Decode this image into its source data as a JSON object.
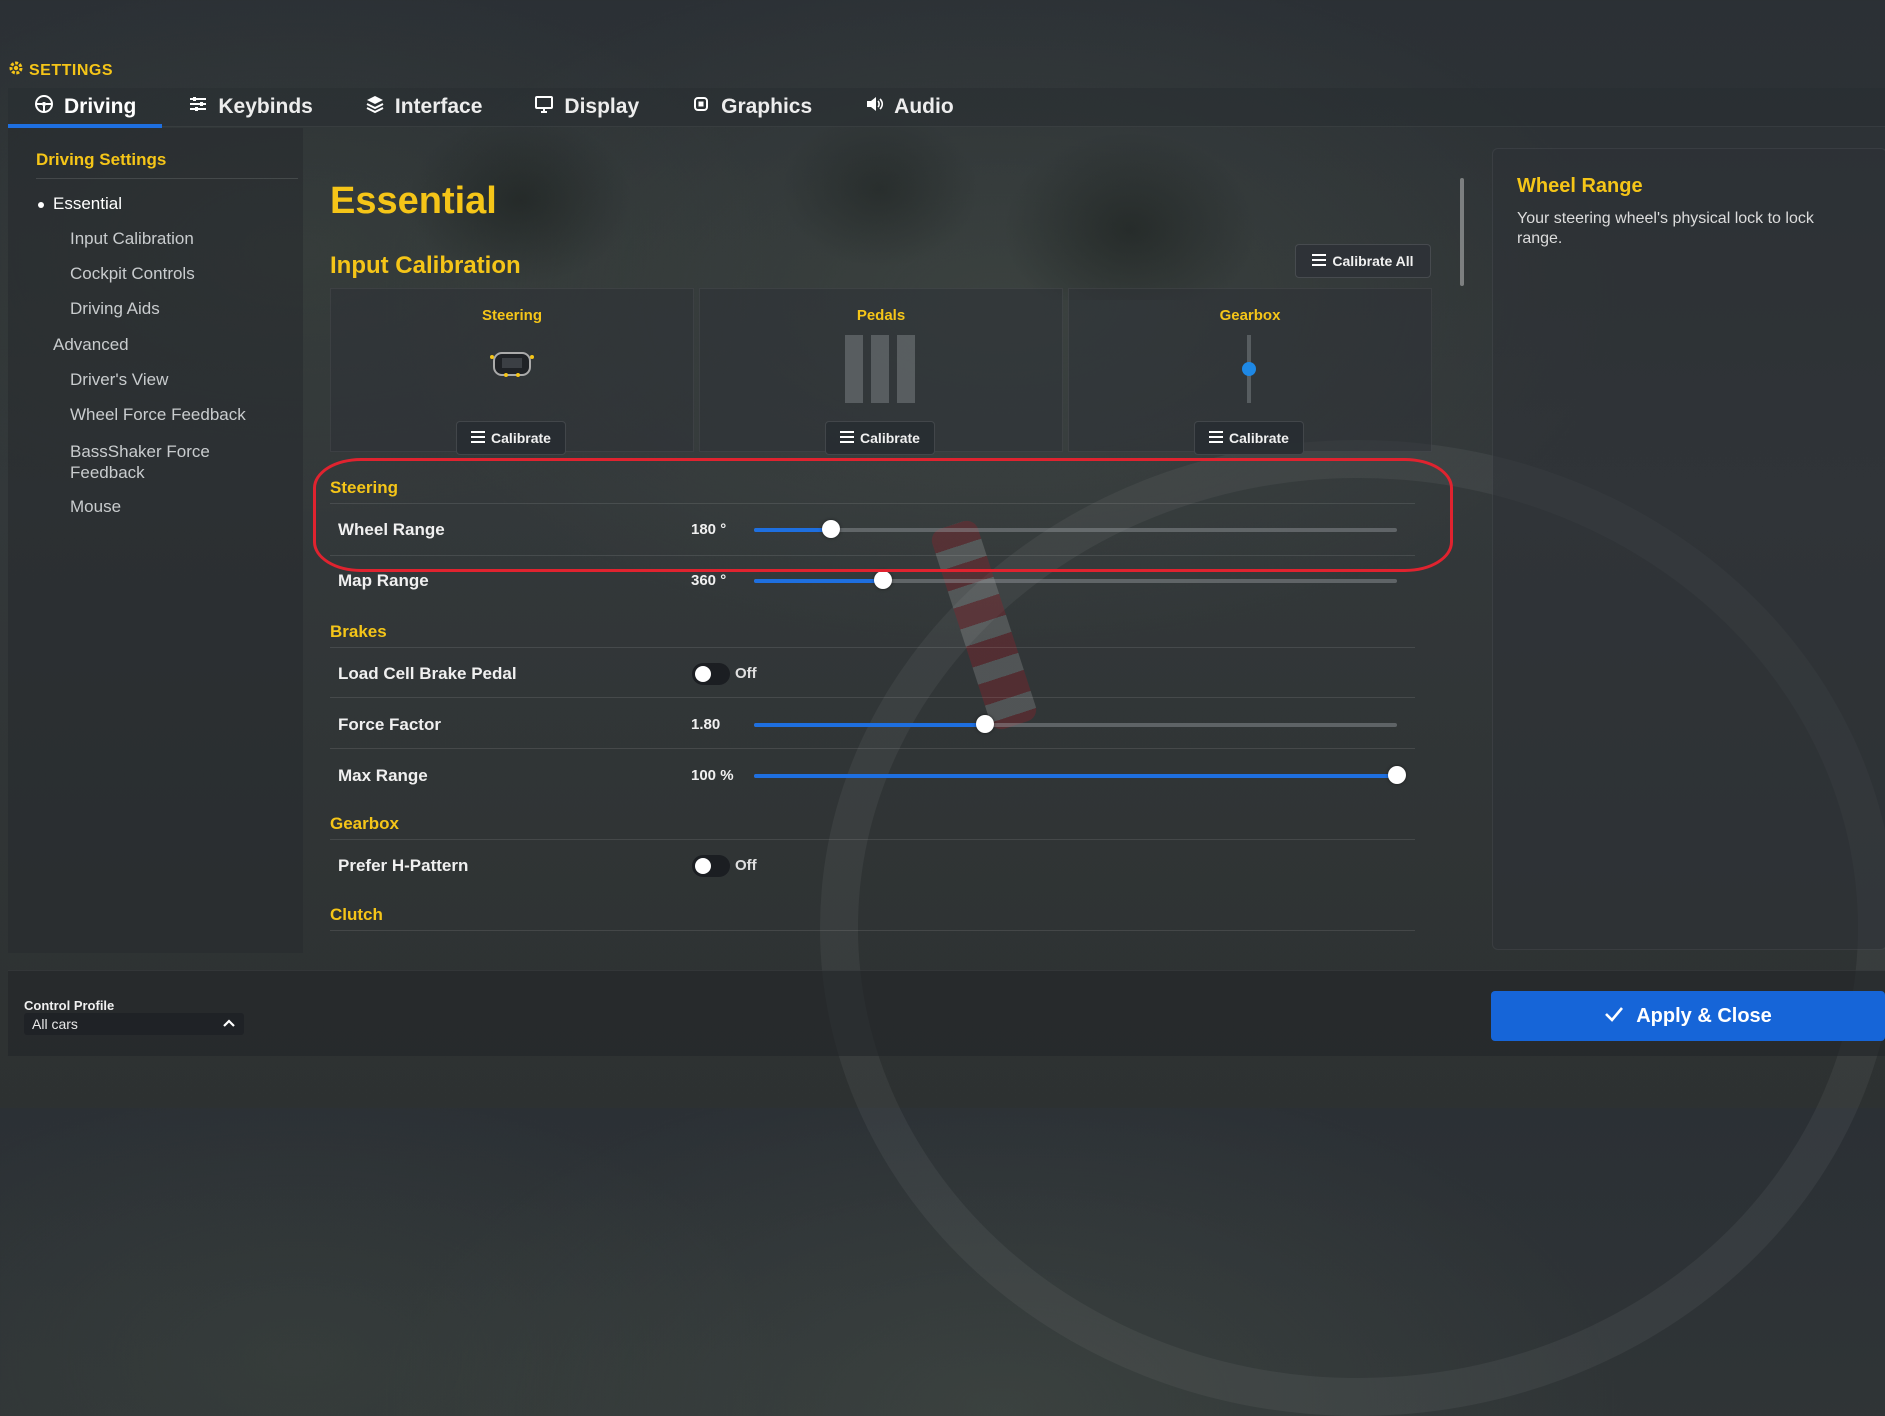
{
  "header": {
    "title": "SETTINGS"
  },
  "tabs": [
    {
      "label": "Driving",
      "icon": "steering-wheel-icon",
      "active": true
    },
    {
      "label": "Keybinds",
      "icon": "sliders-icon",
      "active": false
    },
    {
      "label": "Interface",
      "icon": "layers-icon",
      "active": false
    },
    {
      "label": "Display",
      "icon": "monitor-icon",
      "active": false
    },
    {
      "label": "Graphics",
      "icon": "chip-icon",
      "active": false
    },
    {
      "label": "Audio",
      "icon": "speaker-icon",
      "active": false
    }
  ],
  "sidebar": {
    "title": "Driving Settings",
    "items": [
      {
        "label": "Essential",
        "active": true
      },
      {
        "label": "Input Calibration"
      },
      {
        "label": "Cockpit Controls"
      },
      {
        "label": "Driving Aids"
      },
      {
        "label": "Advanced"
      },
      {
        "label": "Driver's View"
      },
      {
        "label": "Wheel Force Feedback"
      },
      {
        "label": "BassShaker Force\nFeedback"
      },
      {
        "label": "Mouse"
      }
    ]
  },
  "main": {
    "title": "Essential",
    "input_calibration": {
      "title": "Input Calibration",
      "calibrate_all_label": "Calibrate All",
      "cards": [
        {
          "title": "Steering",
          "button": "Calibrate"
        },
        {
          "title": "Pedals",
          "button": "Calibrate"
        },
        {
          "title": "Gearbox",
          "button": "Calibrate"
        }
      ]
    },
    "steering": {
      "title": "Steering",
      "wheel_range": {
        "label": "Wheel Range",
        "value": "180 °",
        "fraction": 0.12
      },
      "map_range": {
        "label": "Map Range",
        "value": "360 °",
        "fraction": 0.2
      }
    },
    "brakes": {
      "title": "Brakes",
      "load_cell": {
        "label": "Load Cell Brake Pedal",
        "state": "Off"
      },
      "force_factor": {
        "label": "Force Factor",
        "value": "1.80",
        "fraction": 0.36
      },
      "max_range": {
        "label": "Max Range",
        "value": "100 %",
        "fraction": 1.0
      }
    },
    "gearbox": {
      "title": "Gearbox",
      "prefer_h": {
        "label": "Prefer H-Pattern",
        "state": "Off"
      }
    },
    "clutch": {
      "title": "Clutch"
    }
  },
  "info": {
    "title": "Wheel Range",
    "text": "Your steering wheel's physical lock to lock range."
  },
  "footer": {
    "control_profile_label": "Control Profile",
    "control_profile_value": "All cars",
    "apply_label": "Apply & Close"
  },
  "colors": {
    "accent": "#f5c518",
    "primary": "#1e6fe0",
    "highlight": "#e0232f"
  }
}
